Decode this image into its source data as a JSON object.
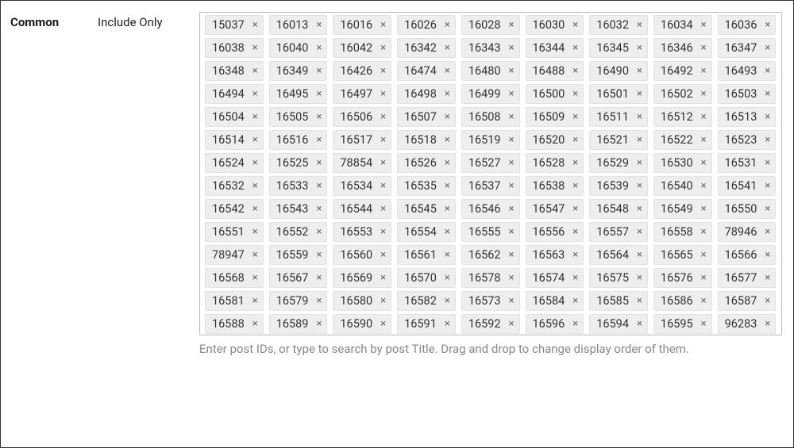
{
  "section_label": "Common",
  "field_label": "Include Only",
  "help_text": "Enter post IDs, or type to search by post Title. Drag and drop to change display order of them.",
  "remove_glyph": "×",
  "tags": [
    "15037",
    "16013",
    "16016",
    "16026",
    "16028",
    "16030",
    "16032",
    "16034",
    "16036",
    "16038",
    "16040",
    "16042",
    "16342",
    "16343",
    "16344",
    "16345",
    "16346",
    "16347",
    "16348",
    "16349",
    "16426",
    "16474",
    "16480",
    "16488",
    "16490",
    "16492",
    "16493",
    "16494",
    "16495",
    "16497",
    "16498",
    "16499",
    "16500",
    "16501",
    "16502",
    "16503",
    "16504",
    "16505",
    "16506",
    "16507",
    "16508",
    "16509",
    "16511",
    "16512",
    "16513",
    "16514",
    "16516",
    "16517",
    "16518",
    "16519",
    "16520",
    "16521",
    "16522",
    "16523",
    "16524",
    "16525",
    "78854",
    "16526",
    "16527",
    "16528",
    "16529",
    "16530",
    "16531",
    "16532",
    "16533",
    "16534",
    "16535",
    "16537",
    "16538",
    "16539",
    "16540",
    "16541",
    "16542",
    "16543",
    "16544",
    "16545",
    "16546",
    "16547",
    "16548",
    "16549",
    "16550",
    "16551",
    "16552",
    "16553",
    "16554",
    "16555",
    "16556",
    "16557",
    "16558",
    "78946",
    "78947",
    "16559",
    "16560",
    "16561",
    "16562",
    "16563",
    "16564",
    "16565",
    "16566",
    "16568",
    "16567",
    "16569",
    "16570",
    "16578",
    "16574",
    "16575",
    "16576",
    "16577",
    "16581",
    "16579",
    "16580",
    "16582",
    "16573",
    "16584",
    "16585",
    "16586",
    "16587",
    "16588",
    "16589",
    "16590",
    "16591",
    "16592",
    "16596",
    "16594",
    "16595",
    "96283"
  ]
}
